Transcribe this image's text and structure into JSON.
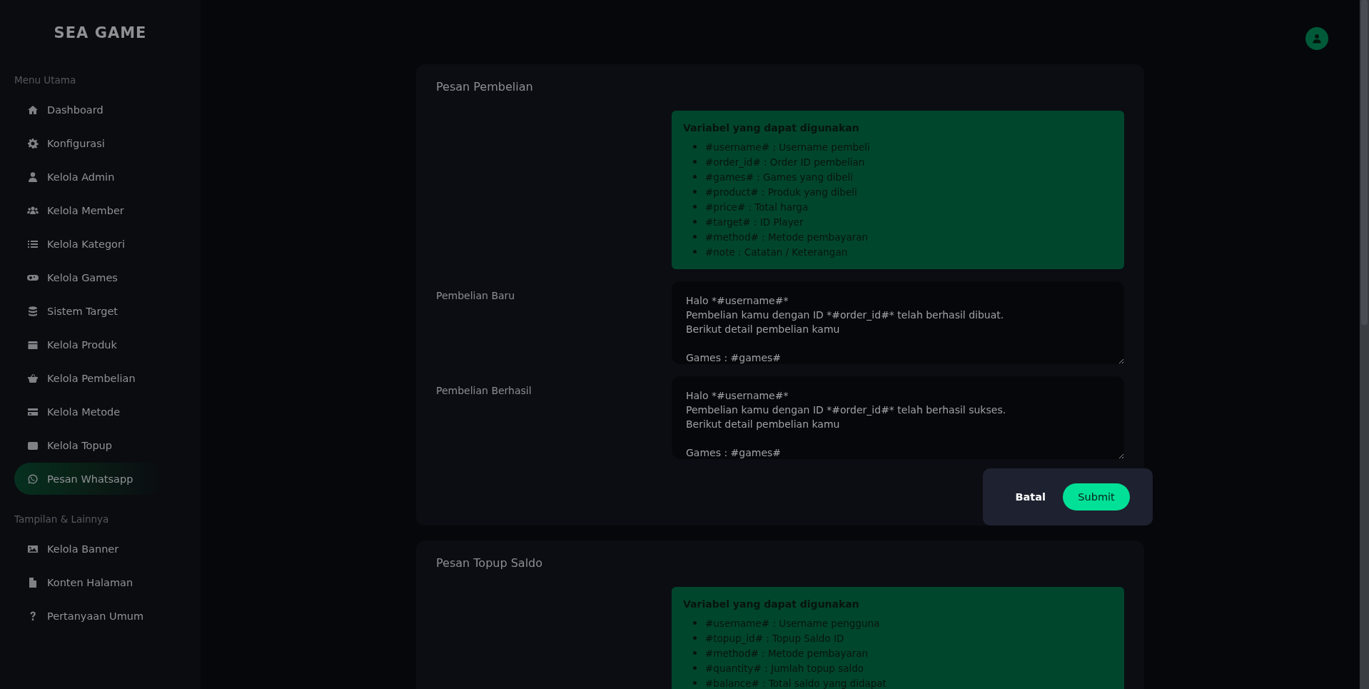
{
  "sidebar": {
    "logo": "SEA GAME",
    "sections": [
      {
        "heading": "Menu Utama",
        "items": [
          {
            "label": "Dashboard",
            "selected": false
          },
          {
            "label": "Konfigurasi",
            "selected": false
          },
          {
            "label": "Kelola Admin",
            "selected": false
          },
          {
            "label": "Kelola Member",
            "selected": false
          },
          {
            "label": "Kelola Kategori",
            "selected": false
          },
          {
            "label": "Kelola Games",
            "selected": false
          },
          {
            "label": "Sistem Target",
            "selected": false
          },
          {
            "label": "Kelola Produk",
            "selected": false
          },
          {
            "label": "Kelola Pembelian",
            "selected": false
          },
          {
            "label": "Kelola Metode",
            "selected": false
          },
          {
            "label": "Kelola Topup",
            "selected": false
          },
          {
            "label": "Pesan Whatsapp",
            "selected": true
          }
        ]
      },
      {
        "heading": "Tampilan & Lainnya",
        "items": [
          {
            "label": "Kelola Banner",
            "selected": false
          },
          {
            "label": "Konten Halaman",
            "selected": false
          },
          {
            "label": "Pertanyaan Umum",
            "selected": false
          }
        ]
      }
    ]
  },
  "cards": [
    {
      "title": "Pesan Pembelian",
      "variables_heading": "Variabel yang dapat digunakan",
      "variables": [
        "#username# : Username pembeli",
        "#order_id# : Order ID pembelian",
        "#games# : Games yang dibeli",
        "#product# : Produk yang dibeli",
        "#price# : Total harga",
        "#target# : ID Player",
        "#method# : Metode pembayaran",
        "#note : Catatan / Keterangan"
      ],
      "fields": [
        {
          "label": "Pembelian Baru",
          "value": "Halo *#username#*\nPembelian kamu dengan ID *#order_id#* telah berhasil dibuat.\nBerikut detail pembelian kamu\n\nGames : #games#"
        },
        {
          "label": "Pembelian Berhasil",
          "value": "Halo *#username#*\nPembelian kamu dengan ID *#order_id#* telah berhasil sukses.\nBerikut detail pembelian kamu\n\nGames : #games#"
        }
      ],
      "actions": [
        {
          "label": "Batal",
          "kind": "cancel"
        },
        {
          "label": "Submit",
          "kind": "submit"
        }
      ]
    },
    {
      "title": "Pesan Topup Saldo",
      "variables_heading": "Variabel yang dapat digunakan",
      "variables": [
        "#username# : Username pengguna",
        "#topup_id# : Topup Saldo ID",
        "#method# : Metode pembayaran",
        "#quantity# : Jumlah topup saldo",
        "#balance# : Total saldo yang didapat"
      ]
    }
  ]
}
